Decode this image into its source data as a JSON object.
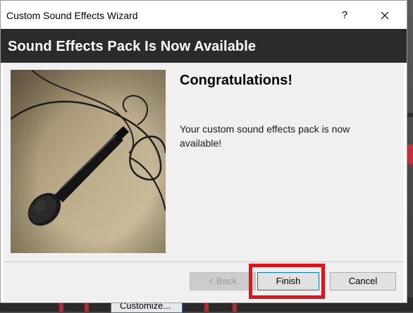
{
  "dialog": {
    "title": "Custom Sound Effects Wizard",
    "help_glyph": "?",
    "close_icon": "close-icon"
  },
  "header": {
    "text": "Sound Effects Pack Is Now Available"
  },
  "content": {
    "heading": "Congratulations!",
    "message": "Your custom sound effects pack is now available!",
    "image": "microphone-photo"
  },
  "buttons": {
    "back_label": "< Back",
    "finish_label": "Finish",
    "cancel_label": "Cancel"
  },
  "background": {
    "customize_label": "Customize..."
  },
  "colors": {
    "header_bg": "#2b2b2b",
    "highlight": "#e0121b",
    "focus_border": "#0078d7"
  }
}
